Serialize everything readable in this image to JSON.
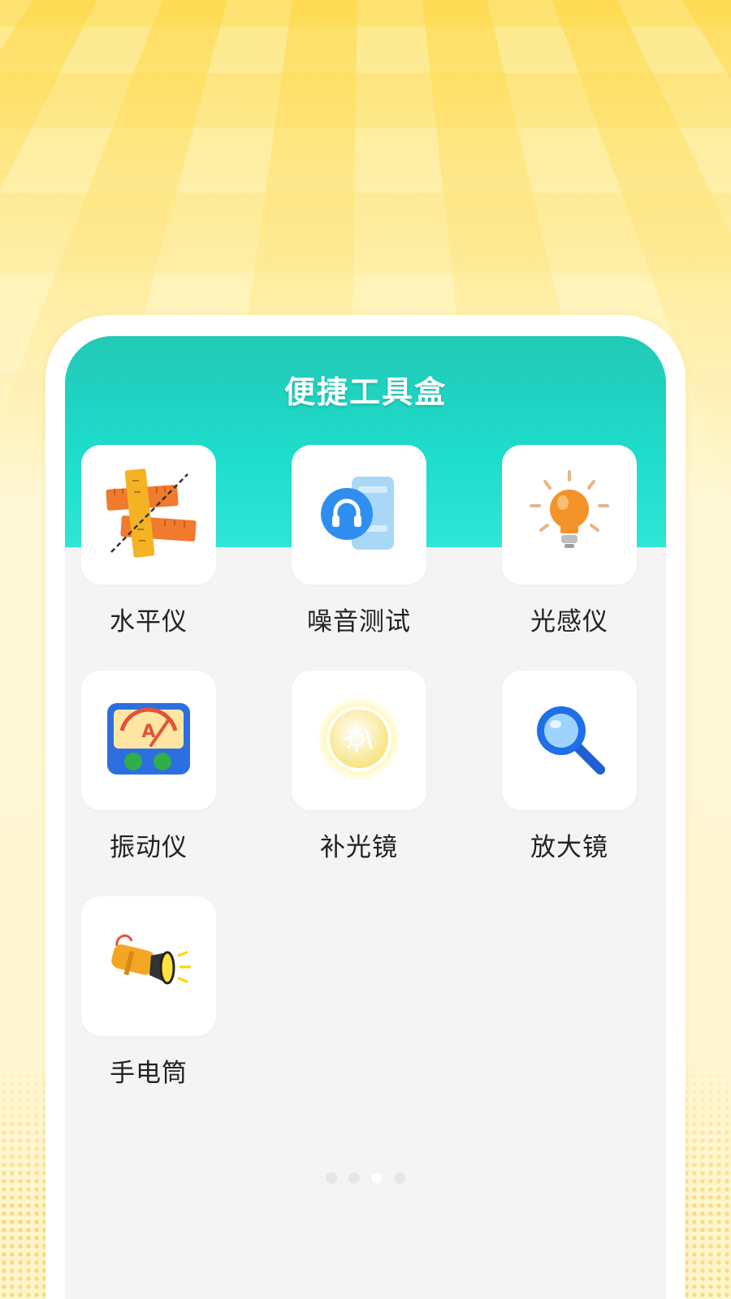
{
  "header": {
    "title": "便捷工具盒"
  },
  "tools": [
    {
      "label": "水平仪",
      "icon": "spirit-level-ruler-icon"
    },
    {
      "label": "噪音测试",
      "icon": "headphones-noise-icon"
    },
    {
      "label": "光感仪",
      "icon": "light-bulb-icon"
    },
    {
      "label": "振动仪",
      "icon": "vibration-meter-icon"
    },
    {
      "label": "补光镜",
      "icon": "fill-light-mirror-icon"
    },
    {
      "label": "放大镜",
      "icon": "magnifier-icon"
    },
    {
      "label": "手电筒",
      "icon": "flashlight-icon"
    }
  ],
  "pager": {
    "count": 4,
    "active_index": 2
  },
  "colors": {
    "accent": "#22c9b6",
    "background": "#fef3b8",
    "panel": "#f4f4f4"
  }
}
